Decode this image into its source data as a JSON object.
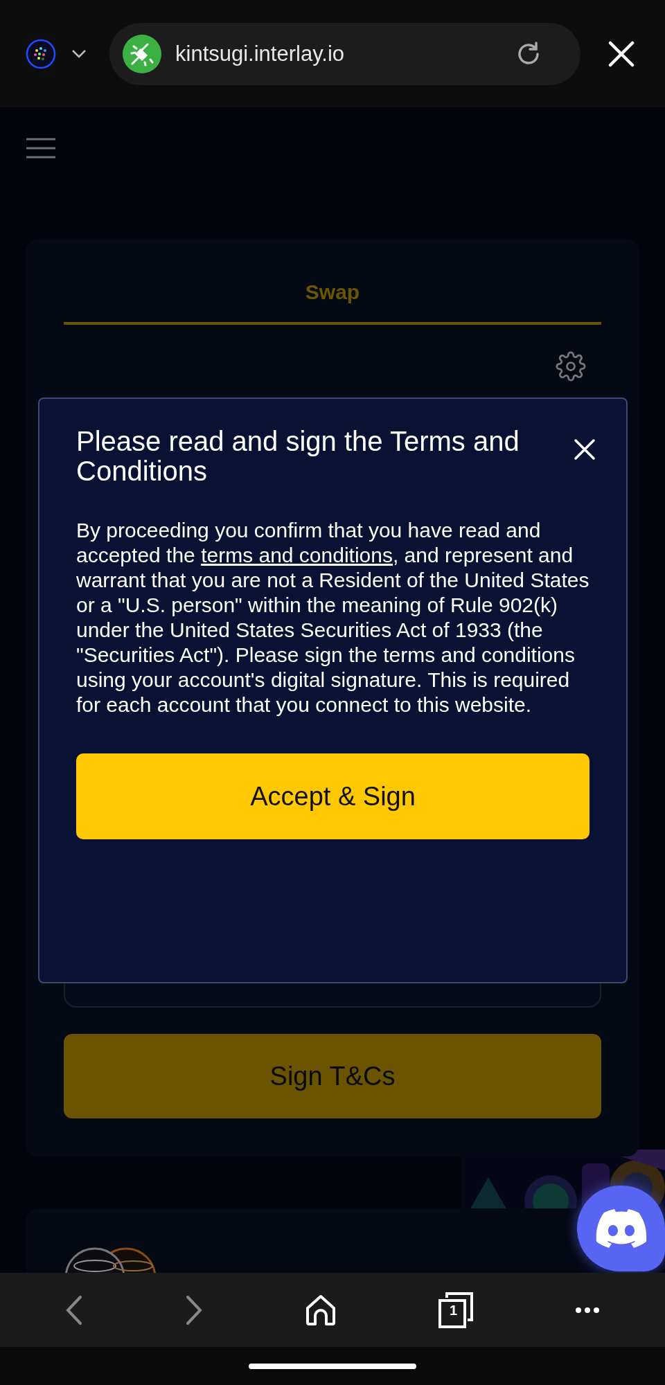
{
  "browser": {
    "url": "kintsugi.interlay.io",
    "tab_count": "1"
  },
  "swap_card": {
    "tabs": [
      {
        "label": "Swap",
        "selected": true
      }
    ],
    "button": "Sign T&Cs"
  },
  "modal": {
    "title": "Please read and sign the Terms and Conditions",
    "body_before": "By proceeding you confirm that you have read and accepted the ",
    "link": "terms and conditions",
    "body_after": ", and represent and warrant that you are not a Resident of the United States or a \"U.S. person\" within the meaning of Rule 902(k) under the United States Securities Act of 1933 (the \"Securities Act\"). Please sign the terms and conditions using your account's digital signature. This is required for each account that you connect to this website.",
    "button": "Accept & Sign"
  }
}
